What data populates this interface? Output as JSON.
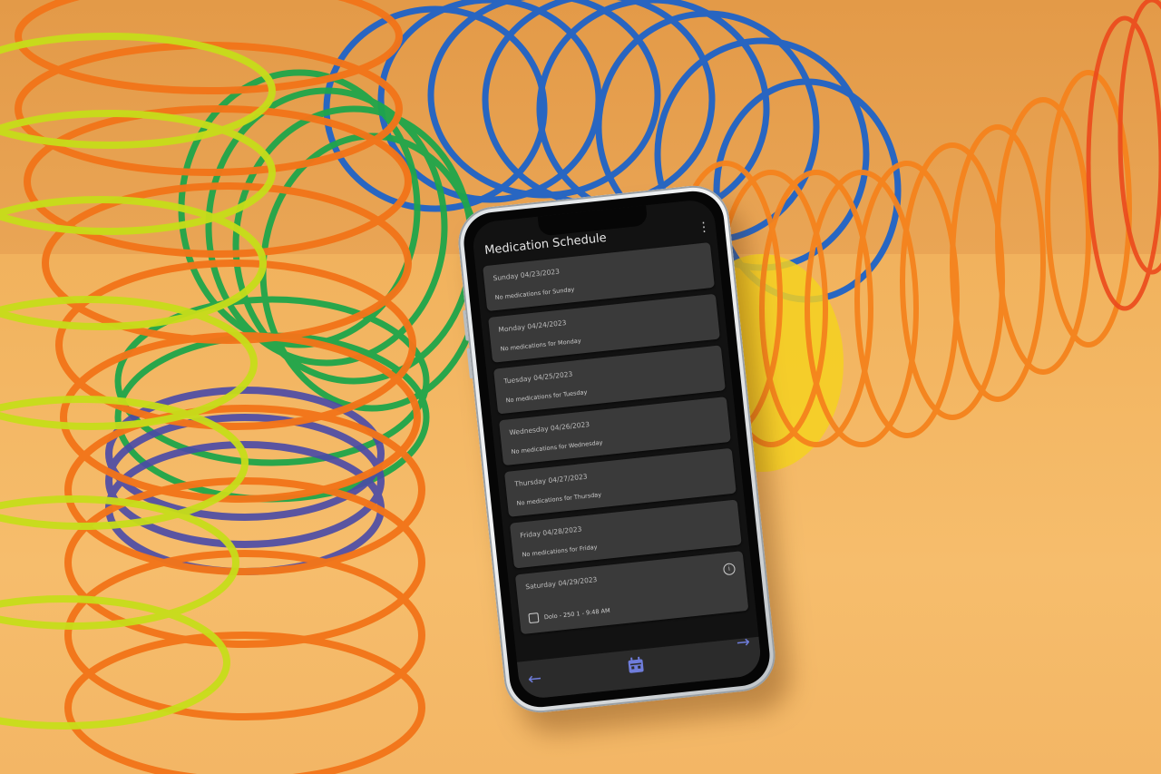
{
  "app": {
    "title": "Medication Schedule",
    "menu_icon": "more-vert-icon"
  },
  "days": [
    {
      "date": "Sunday 04/23/2023",
      "status": "No medications for Sunday"
    },
    {
      "date": "Monday 04/24/2023",
      "status": "No medications for Monday"
    },
    {
      "date": "Tuesday 04/25/2023",
      "status": "No medications for Tuesday"
    },
    {
      "date": "Wednesday 04/26/2023",
      "status": "No medications for Wednesday"
    },
    {
      "date": "Thursday 04/27/2023",
      "status": "No medications for Thursday"
    },
    {
      "date": "Friday 04/28/2023",
      "status": "No medications for Friday"
    }
  ],
  "saturday": {
    "date": "Saturday 04/29/2023",
    "info_icon": "info-icon",
    "medication": "Dolo - 250 1 - 9:48 AM"
  },
  "nav": {
    "back_icon": "arrow-left-icon",
    "calendar_icon": "calendar-icon",
    "forward_icon": "arrow-right-icon"
  },
  "colors": {
    "screen_bg": "#121212",
    "card_bg": "#3a3a3a",
    "accent": "#6f7ddb",
    "background": "#f0ae55"
  }
}
